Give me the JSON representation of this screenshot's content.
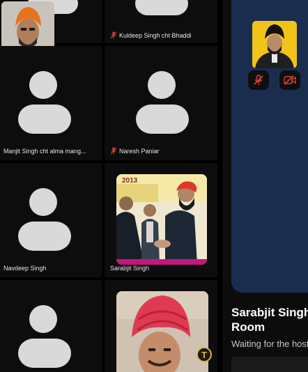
{
  "participants": [
    {
      "name": "Kuldeep Singh cht Bhaddi",
      "muted": true
    },
    {
      "name": "Manjit Singh cht alma mang...",
      "muted": false
    },
    {
      "name": "Naresh Paniar",
      "muted": true
    },
    {
      "name": "Navdeep Singh",
      "muted": false
    },
    {
      "name": "Sarabjit Singh",
      "muted": false
    }
  ],
  "right_panel": {
    "room_title_line1": "Sarabjit Singh",
    "room_title_line2": "Room",
    "room_subtitle": "Waiting for the host"
  },
  "badge": {
    "letter": "T"
  },
  "colors": {
    "background": "#000000",
    "tile": "#0d0d0d",
    "avatar": "#d9d9d9",
    "panel_blue": "#1b2d4f",
    "accent_blue": "#2667ee",
    "muted_red": "#e0413a",
    "badge_gold": "#e2b233"
  },
  "icons": [
    "mic-off-icon",
    "video-off-icon",
    "t-badge-icon"
  ]
}
